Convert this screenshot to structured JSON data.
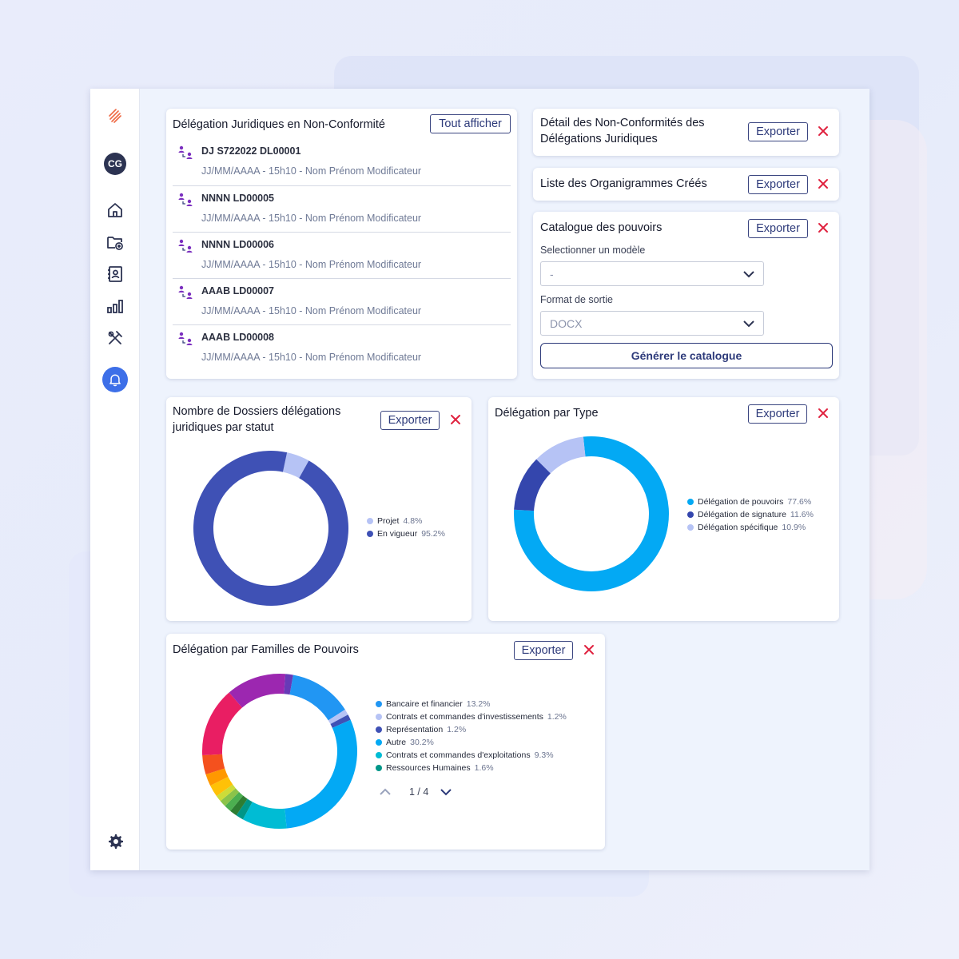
{
  "sidebar": {
    "avatar_initials": "CG",
    "icons": [
      "logo-icon",
      "home-icon",
      "folder-add-icon",
      "contacts-icon",
      "bar-chart-icon",
      "tools-icon",
      "bell-icon",
      "settings-icon"
    ]
  },
  "non_conformity": {
    "title": "Délégation Juridiques en Non-Conformité",
    "show_all_label": "Tout afficher",
    "items": [
      {
        "title": "DJ S722022 DL00001",
        "subtitle": "JJ/MM/AAAA - 15h10 - Nom Prénom Modificateur"
      },
      {
        "title": "NNNN LD00005",
        "subtitle": "JJ/MM/AAAA - 15h10 - Nom Prénom Modificateur"
      },
      {
        "title": "NNNN LD00006",
        "subtitle": "JJ/MM/AAAA - 15h10 - Nom Prénom Modificateur"
      },
      {
        "title": "AAAB LD00007",
        "subtitle": "JJ/MM/AAAA - 15h10 - Nom Prénom Modificateur"
      },
      {
        "title": "AAAB LD00008",
        "subtitle": "JJ/MM/AAAA - 15h10 - Nom Prénom Modificateur"
      }
    ]
  },
  "detail_card": {
    "title_line1": "Détail des Non-Conformités des",
    "title_line2": "Délégations Juridiques",
    "export_label": "Exporter"
  },
  "org_card": {
    "title": "Liste des Organigrammes Créés",
    "export_label": "Exporter"
  },
  "catalogue": {
    "title": "Catalogue des pouvoirs",
    "export_label": "Exporter",
    "model_label": "Selectionner un modèle",
    "model_value": "-",
    "format_label": "Format de sortie",
    "format_value": "DOCX",
    "generate_label": "Générer le catalogue"
  },
  "status_card": {
    "title_line1": "Nombre de Dossiers délégations",
    "title_line2": "juridiques par statut",
    "export_label": "Exporter"
  },
  "type_card": {
    "title": "Délégation par Type",
    "export_label": "Exporter"
  },
  "families_card": {
    "title": "Délégation par Familles de Pouvoirs",
    "export_label": "Exporter",
    "pager_text": "1 / 4"
  },
  "colors": {
    "accent": "#3d6fe8",
    "danger": "#e0223f",
    "navy": "#2d3a7a"
  },
  "chart_data": [
    {
      "type": "pie",
      "title": "Nombre de Dossiers délégations juridiques par statut",
      "series": [
        {
          "name": "Projet",
          "value": 4.8,
          "pct_label": "4.8%",
          "color": "#b6c3f5"
        },
        {
          "name": "En vigueur",
          "value": 95.2,
          "pct_label": "95.2%",
          "color": "#3f51b5"
        }
      ]
    },
    {
      "type": "pie",
      "title": "Délégation par Type",
      "series": [
        {
          "name": "Délégation de pouvoirs",
          "value": 77.6,
          "pct_label": "77.6%",
          "color": "#03a9f4"
        },
        {
          "name": "Délégation de signature",
          "value": 11.6,
          "pct_label": "11.6%",
          "color": "#3446ad"
        },
        {
          "name": "Délégation spécifique",
          "value": 10.9,
          "pct_label": "10.9%",
          "color": "#b6c3f5"
        }
      ]
    },
    {
      "type": "pie",
      "title": "Délégation par Familles de Pouvoirs",
      "legend_page": 1,
      "legend_pages": 4,
      "series": [
        {
          "name": "Bancaire et financier",
          "value": 13.2,
          "pct_label": "13.2%",
          "color": "#2196f3",
          "in_legend": true
        },
        {
          "name": "Contrats et commandes d'investissements",
          "value": 1.2,
          "pct_label": "1.2%",
          "color": "#b6c3f5",
          "in_legend": true
        },
        {
          "name": "Représentation",
          "value": 1.2,
          "pct_label": "1.2%",
          "color": "#3f51b5",
          "in_legend": true
        },
        {
          "name": "Autre",
          "value": 30.2,
          "pct_label": "30.2%",
          "color": "#03a9f4",
          "in_legend": true
        },
        {
          "name": "Contrats et commandes d'exploitations",
          "value": 9.3,
          "pct_label": "9.3%",
          "color": "#00bcd4",
          "in_legend": true
        },
        {
          "name": "Ressources Humaines",
          "value": 1.6,
          "pct_label": "1.6%",
          "color": "#009688",
          "in_legend": true
        },
        {
          "value": 1.5,
          "color": "#2e7d32",
          "in_legend": false
        },
        {
          "value": 1.5,
          "color": "#4caf50",
          "in_legend": false
        },
        {
          "value": 1.4,
          "color": "#8bc34a",
          "in_legend": false
        },
        {
          "value": 1.3,
          "color": "#cddc39",
          "in_legend": false
        },
        {
          "value": 2.5,
          "color": "#ffc107",
          "in_legend": false
        },
        {
          "value": 2.5,
          "color": "#ff9800",
          "in_legend": false
        },
        {
          "value": 4.0,
          "color": "#f4511e",
          "in_legend": false
        },
        {
          "value": 14.5,
          "color": "#e91e63",
          "in_legend": false
        },
        {
          "value": 12.5,
          "color": "#9c27b0",
          "in_legend": false
        },
        {
          "value": 1.6,
          "color": "#673ab7",
          "in_legend": false
        }
      ]
    }
  ]
}
